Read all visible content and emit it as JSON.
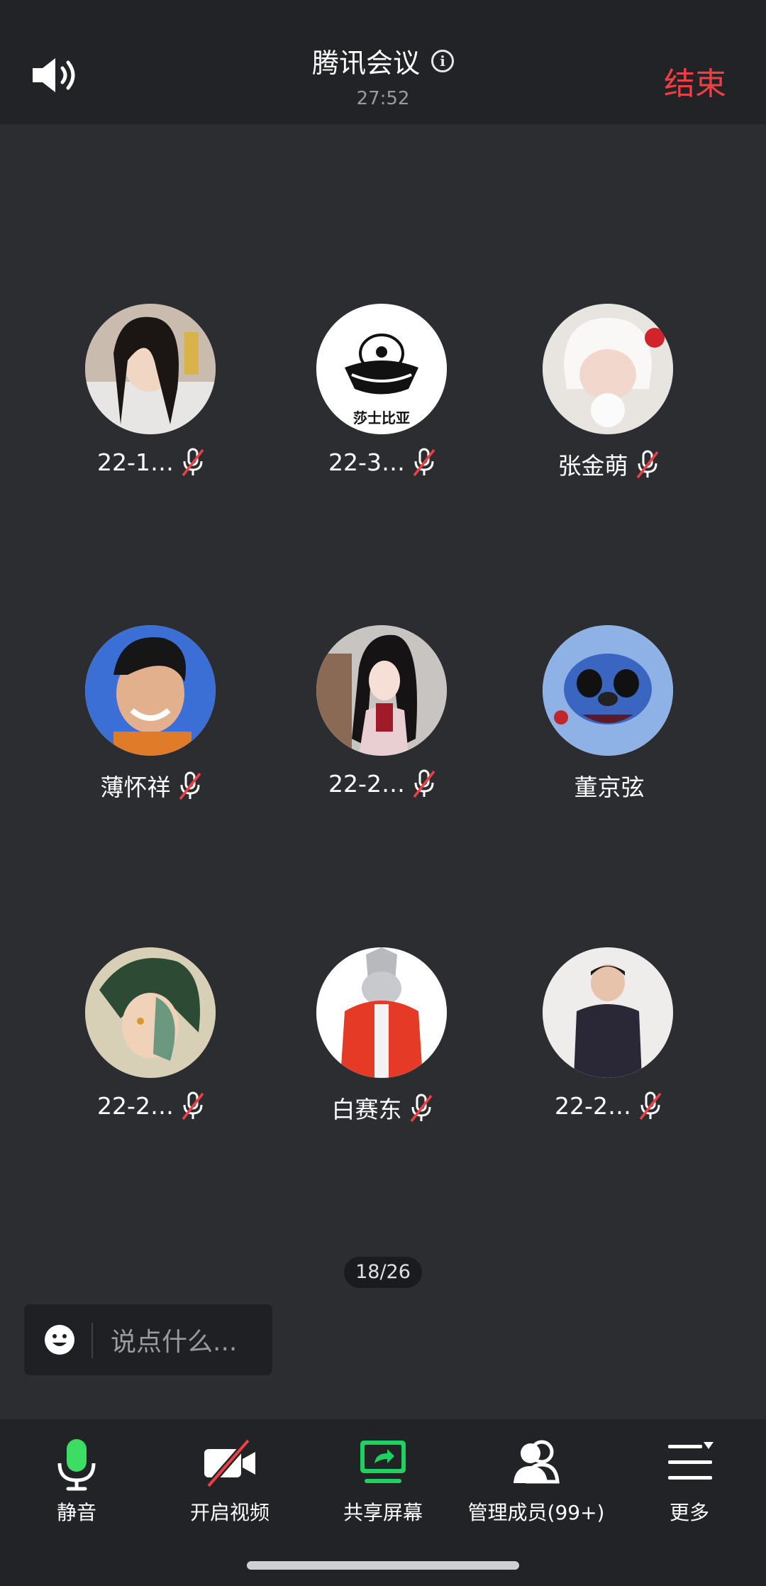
{
  "header": {
    "title": "腾讯会议",
    "timer": "27:52",
    "end_label": "结束"
  },
  "participants": [
    {
      "name": "22-1…",
      "muted": true
    },
    {
      "name": "22-3…",
      "muted": true
    },
    {
      "name": "张金萌",
      "muted": true
    },
    {
      "name": "薄怀祥",
      "muted": true
    },
    {
      "name": "22-2…",
      "muted": true
    },
    {
      "name": "董京弦",
      "muted": false
    },
    {
      "name": "22-2…",
      "muted": true
    },
    {
      "name": "白赛东",
      "muted": true
    },
    {
      "name": "22-2…",
      "muted": true
    }
  ],
  "pager": "18/26",
  "chat": {
    "placeholder": "说点什么..."
  },
  "toolbar": {
    "mute_label": "静音",
    "video_label": "开启视频",
    "share_label": "共享屏幕",
    "members_label": "管理成员(99+)",
    "more_label": "更多"
  },
  "colors": {
    "end": "#ee3f45",
    "mic_active": "#3ddc62",
    "share": "#1fd15f",
    "background": "#2b2d31"
  }
}
